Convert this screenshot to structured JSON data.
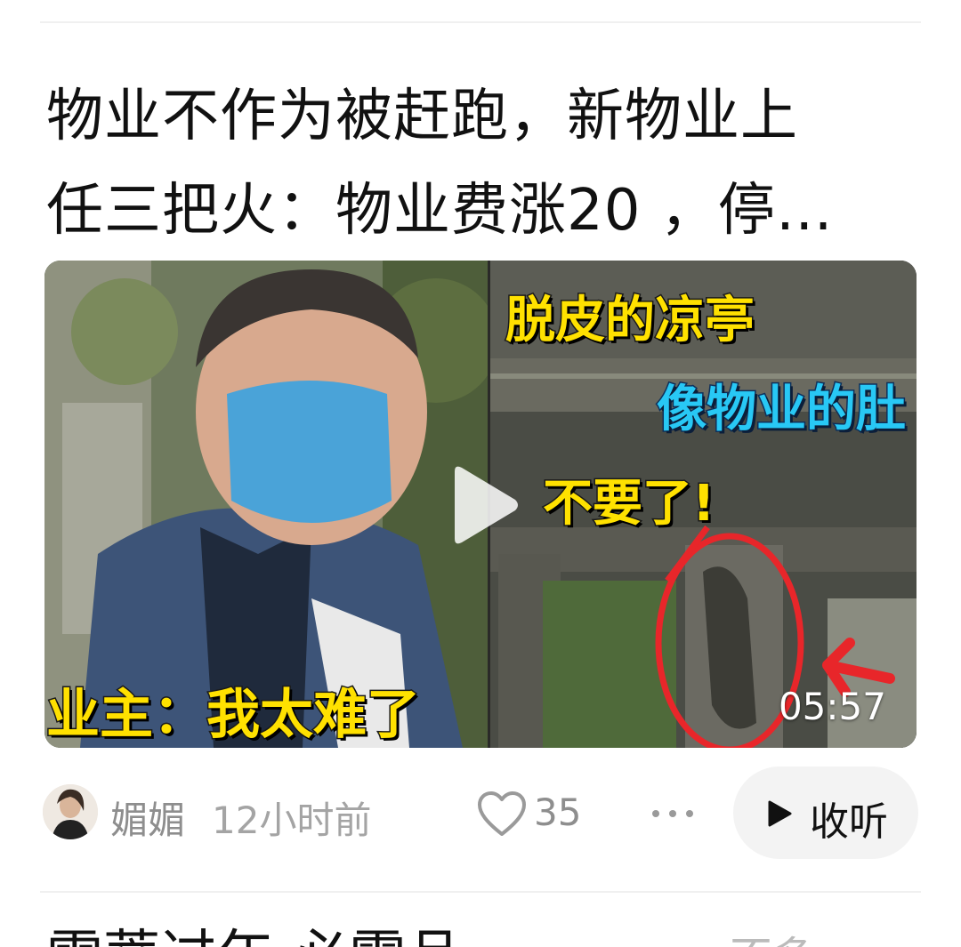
{
  "post": {
    "title_line1": "物业不作为被赶跑，新物业上",
    "title_line2": "任三把火：物业费涨20 ，停…",
    "thumbnail": {
      "caption_left": "业主：我太难了",
      "caption_top": "脱皮的凉亭",
      "caption_middle": "像物业的肚",
      "caption_right": "不要了!",
      "duration": "05:57"
    },
    "author": "媚媚",
    "time": "12小时前",
    "likes": "35",
    "listen_label": "收听"
  },
  "next_post": {
    "title_partial": "雷蒂过年 必需品",
    "right_partial": "不多"
  },
  "icons": [
    "play-icon",
    "heart-icon",
    "more-icon",
    "play-triangle-icon"
  ],
  "colors": {
    "caption_yellow": "#ffe100",
    "caption_blue": "#28c8f5",
    "annotation_red": "#e8262a"
  }
}
